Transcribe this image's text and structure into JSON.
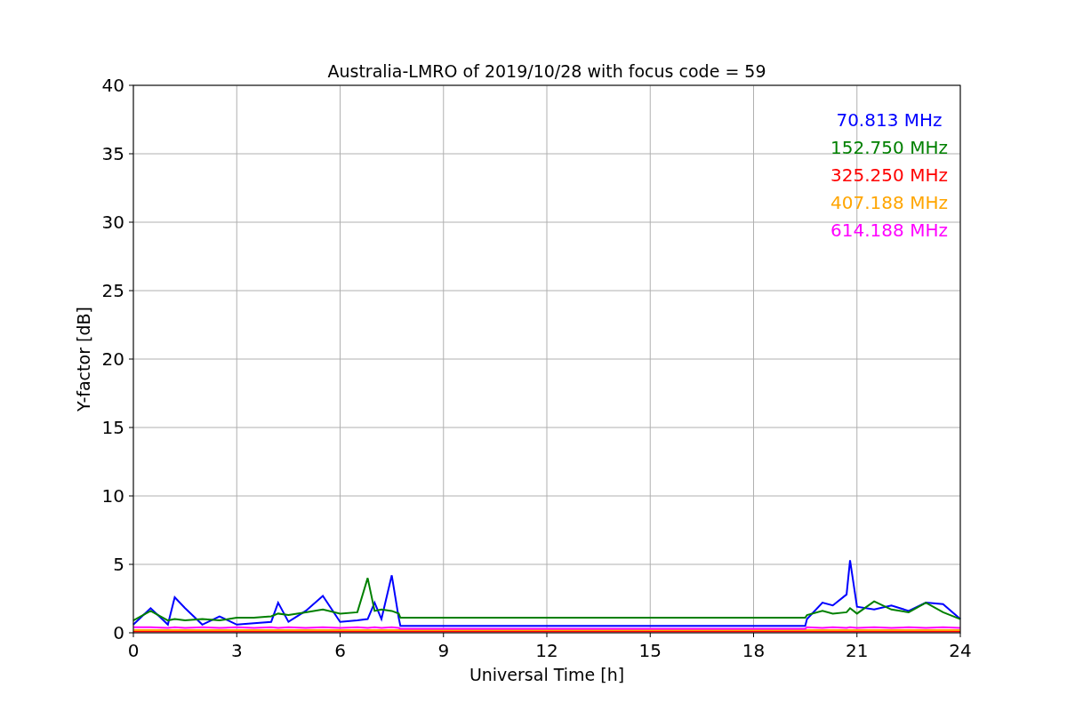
{
  "chart": {
    "chart_data": {
      "type": "line",
      "title": "Australia-LMRO of 2019/10/28 with focus code = 59",
      "xlabel": "Universal Time [h]",
      "ylabel": "Y-factor [dB]",
      "x": [
        0,
        0.5,
        1,
        1.2,
        1.5,
        2,
        2.5,
        3,
        3.5,
        4,
        4.2,
        4.5,
        5,
        5.5,
        6,
        6.5,
        6.8,
        7,
        7.2,
        7.5,
        7.7,
        7.75,
        19.5,
        19.55,
        20,
        20.3,
        20.7,
        20.8,
        21,
        21.5,
        22,
        22.5,
        23,
        23.5,
        24
      ],
      "series": [
        {
          "name": "70.813 MHz",
          "color": "#0000ff",
          "values": [
            0.6,
            1.8,
            0.6,
            2.6,
            1.8,
            0.6,
            1.2,
            0.6,
            0.7,
            0.8,
            2.2,
            0.8,
            1.6,
            2.7,
            0.8,
            0.9,
            1.0,
            2.2,
            1.0,
            4.2,
            1.1,
            0.5,
            0.5,
            1.0,
            2.2,
            2.0,
            2.8,
            5.3,
            1.9,
            1.7,
            2.0,
            1.6,
            2.2,
            2.1,
            1.0
          ]
        },
        {
          "name": "152.750 MHz",
          "color": "#008000",
          "values": [
            0.9,
            1.6,
            0.9,
            1.0,
            0.9,
            1.0,
            0.9,
            1.1,
            1.1,
            1.2,
            1.4,
            1.3,
            1.5,
            1.7,
            1.4,
            1.5,
            4.0,
            1.6,
            1.7,
            1.6,
            1.4,
            1.1,
            1.1,
            1.3,
            1.6,
            1.4,
            1.5,
            1.8,
            1.4,
            2.3,
            1.7,
            1.5,
            2.2,
            1.5,
            1.0
          ]
        },
        {
          "name": "325.250 MHz",
          "color": "#ff0000",
          "values": [
            0.1,
            0.1,
            0.1,
            0.1,
            0.1,
            0.1,
            0.1,
            0.1,
            0.1,
            0.1,
            0.1,
            0.1,
            0.1,
            0.1,
            0.1,
            0.1,
            0.1,
            0.1,
            0.1,
            0.1,
            0.1,
            0.1,
            0.1,
            0.1,
            0.1,
            0.1,
            0.1,
            0.1,
            0.1,
            0.1,
            0.1,
            0.1,
            0.1,
            0.1,
            0.1
          ]
        },
        {
          "name": "407.188 MHz",
          "color": "#ffa500",
          "values": [
            0.2,
            0.2,
            0.2,
            0.2,
            0.2,
            0.2,
            0.2,
            0.2,
            0.2,
            0.2,
            0.2,
            0.2,
            0.2,
            0.2,
            0.2,
            0.2,
            0.2,
            0.2,
            0.2,
            0.2,
            0.2,
            0.2,
            0.2,
            0.2,
            0.2,
            0.2,
            0.2,
            0.2,
            0.2,
            0.2,
            0.2,
            0.2,
            0.2,
            0.2,
            0.2
          ]
        },
        {
          "name": "614.188 MHz",
          "color": "#ff00ff",
          "values": [
            0.4,
            0.4,
            0.35,
            0.4,
            0.35,
            0.4,
            0.35,
            0.4,
            0.35,
            0.4,
            0.35,
            0.4,
            0.35,
            0.4,
            0.35,
            0.4,
            0.35,
            0.4,
            0.35,
            0.4,
            0.35,
            0.3,
            0.3,
            0.4,
            0.35,
            0.4,
            0.35,
            0.4,
            0.35,
            0.4,
            0.35,
            0.4,
            0.35,
            0.4,
            0.35
          ]
        }
      ],
      "grid": true,
      "xlim": [
        0,
        24
      ],
      "ylim": [
        0,
        40
      ],
      "xticks": [
        0,
        3,
        6,
        9,
        12,
        15,
        18,
        21,
        24
      ],
      "yticks": [
        0,
        5,
        10,
        15,
        20,
        25,
        30,
        35,
        40
      ]
    }
  }
}
